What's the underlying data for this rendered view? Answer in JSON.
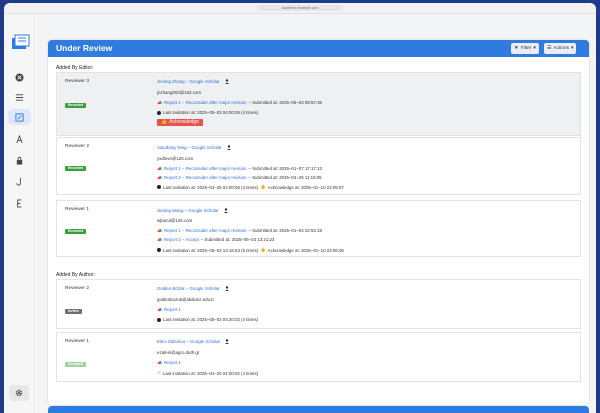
{
  "browser": {
    "url": "academic.example.com"
  },
  "sidebar": {
    "items": [
      {
        "name": "overview-icon",
        "glyph": "⊗"
      },
      {
        "name": "list-icon",
        "glyph": "☰"
      },
      {
        "name": "edit-icon",
        "glyph": "✎"
      },
      {
        "name": "translate-icon",
        "glyph": "A"
      },
      {
        "name": "lock-icon",
        "glyph": "🔒"
      },
      {
        "name": "j-icon",
        "glyph": "J"
      },
      {
        "name": "e-icon",
        "glyph": "E"
      }
    ]
  },
  "panel": {
    "title": "Under Review",
    "filter_label": "Filter",
    "actions_label": "Actions"
  },
  "added_by_editor_label": "Added By Editor:",
  "added_by_author_label": "Added By Author:",
  "editor_reviewers": [
    {
      "label": "Reviewer 3",
      "status": "Recorded",
      "name": "Jinning Zhang – Google Scholar",
      "email": "jnzhang003@163.com",
      "reports": [
        {
          "link": "Report 1 – Reconsider after major revision",
          "submitted": "– Submitted at: 2025–05–03 09:57:36"
        }
      ],
      "invitation": "Last invitation at: 2025–05–03 04:00:05 (4 times)",
      "acknowledge_button": "Acknowledge"
    },
    {
      "label": "Reviewer 2",
      "status": "Recorded",
      "name": "Xiaodong Yang – Google Scholar",
      "email": "yxdlove@126.com",
      "reports": [
        {
          "link": "Report 1 – Reconsider after major revision",
          "submitted": "– Submitted at: 2025–01–07 17:17:13"
        },
        {
          "link": "Report 2 – Reconsider after major revision",
          "submitted": "– Submitted at: 2025–04–25 11:16:05"
        }
      ],
      "invitation": "Last invitation at: 2025–04–25 04:00:06 (4 times)",
      "acknowledge": "Acknowledge at: 2025–01–10 22:05:07"
    },
    {
      "label": "Reviewer 1",
      "status": "Recorded",
      "name": "Jianing Wang – Google Scholar",
      "email": "wjtarcd@126.com",
      "reports": [
        {
          "link": "Report 1 – Reconsider after major revision",
          "submitted": "– Submitted at: 2025–01–04 22:53:18"
        },
        {
          "link": "Report 2 – Accept",
          "submitted": "– Submitted at: 2025–05–03 13:21:23"
        }
      ],
      "invitation": "Last invitation at: 2025–05–03 13:16:53 (5 times)",
      "acknowledge": "Acknowledge at: 2025–01–10 22:05:06"
    }
  ],
  "author_reviewers": [
    {
      "label": "Reviewer 2",
      "status": "Invited",
      "name": "Gulden Bözük – Google Scholar",
      "email": "guldenbozuk@akdeniz.edu.tr",
      "reports": [
        {
          "link": "Report 1",
          "submitted": ""
        }
      ],
      "invitation": "Last invitation at: 2025–05–03 04:30:02 (4 times)"
    },
    {
      "label": "Reviewer 1",
      "status": "Accepted",
      "name": "Eleni Zafeiriou – Google Scholar",
      "email": "ezafeiri@agro.duth.gr",
      "reports": [
        {
          "link": "Report 1",
          "submitted": ""
        }
      ],
      "invitation": "Last invitation at: 2025–04–25 04:00:02 (4 times)"
    }
  ],
  "colors": {
    "accent": "#2f7be0",
    "recorded": "#3b9c3b",
    "invited": "#6b6f75",
    "accepted": "#9bd39b",
    "danger": "#e5534b"
  }
}
